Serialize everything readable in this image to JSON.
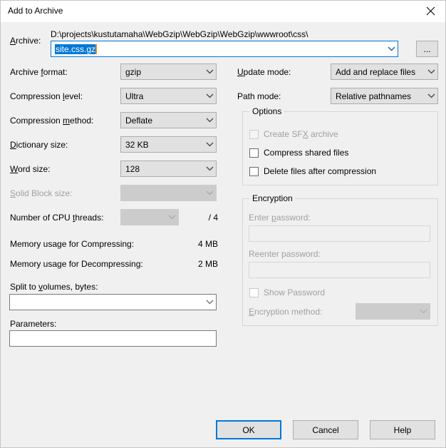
{
  "window": {
    "title": "Add to Archive",
    "close_icon": "close-icon"
  },
  "archive": {
    "label": "Archive:",
    "label_accel": "A",
    "path": "D:\\projects\\kustutamaha\\WebGzip\\WebGzip\\WebGzip\\wwwroot\\css\\",
    "filename": "site.css.gz",
    "browse_label": "..."
  },
  "left_fields": [
    {
      "label": "Archive format:",
      "accel": "f",
      "value": "gzip",
      "disabled": false
    },
    {
      "label": "Compression level:",
      "accel": "l",
      "value": "Ultra",
      "disabled": false
    },
    {
      "label": "Compression method:",
      "accel": "m",
      "value": "Deflate",
      "disabled": false
    },
    {
      "label": "Dictionary size:",
      "accel": "D",
      "value": "32 KB",
      "disabled": false
    },
    {
      "label": "Word size:",
      "accel": "W",
      "value": "128",
      "disabled": false
    },
    {
      "label": "Solid Block size:",
      "accel": "S",
      "value": "",
      "disabled": true
    },
    {
      "label": "Number of CPU threads:",
      "accel": "t",
      "value": "",
      "disabled": true
    }
  ],
  "cpu_threads_total": "/ 4",
  "memory": {
    "compress_label": "Memory usage for Compressing:",
    "compress_value": "4 MB",
    "decompress_label": "Memory usage for Decompressing:",
    "decompress_value": "2 MB"
  },
  "split": {
    "label": "Split to volumes, bytes:",
    "accel": "v",
    "value": "",
    "placeholder": ""
  },
  "parameters": {
    "label": "Parameters:",
    "value": "",
    "placeholder": ""
  },
  "right_fields": [
    {
      "label": "Update mode:",
      "accel": "U",
      "value": "Add and replace files"
    },
    {
      "label": "Path mode:",
      "accel": "",
      "value": "Relative pathnames"
    }
  ],
  "options": {
    "title": "Options",
    "items": [
      {
        "label": "Create SFX archive",
        "accel": "X",
        "checked": false,
        "disabled": true
      },
      {
        "label": "Compress shared files",
        "accel": "",
        "checked": false,
        "disabled": false
      },
      {
        "label": "Delete files after compression",
        "accel": "",
        "checked": false,
        "disabled": false
      }
    ]
  },
  "encryption": {
    "title": "Encryption",
    "enter_password_label": "Enter password:",
    "enter_password_accel": "p",
    "enter_password_value": "",
    "reenter_password_label": "Reenter password:",
    "reenter_password_value": "",
    "show_password_label": "Show Password",
    "show_password_checked": false,
    "method_label": "Encryption method:",
    "method_accel": "E",
    "method_value": ""
  },
  "buttons": {
    "ok": "OK",
    "cancel": "Cancel",
    "help": "Help"
  },
  "colors": {
    "accent": "#0078d7",
    "dialog_bg": "#f0f0f0",
    "control_bg": "#e1e1e1",
    "disabled_text": "#a0a0a0",
    "caret": "#e08a1e"
  }
}
